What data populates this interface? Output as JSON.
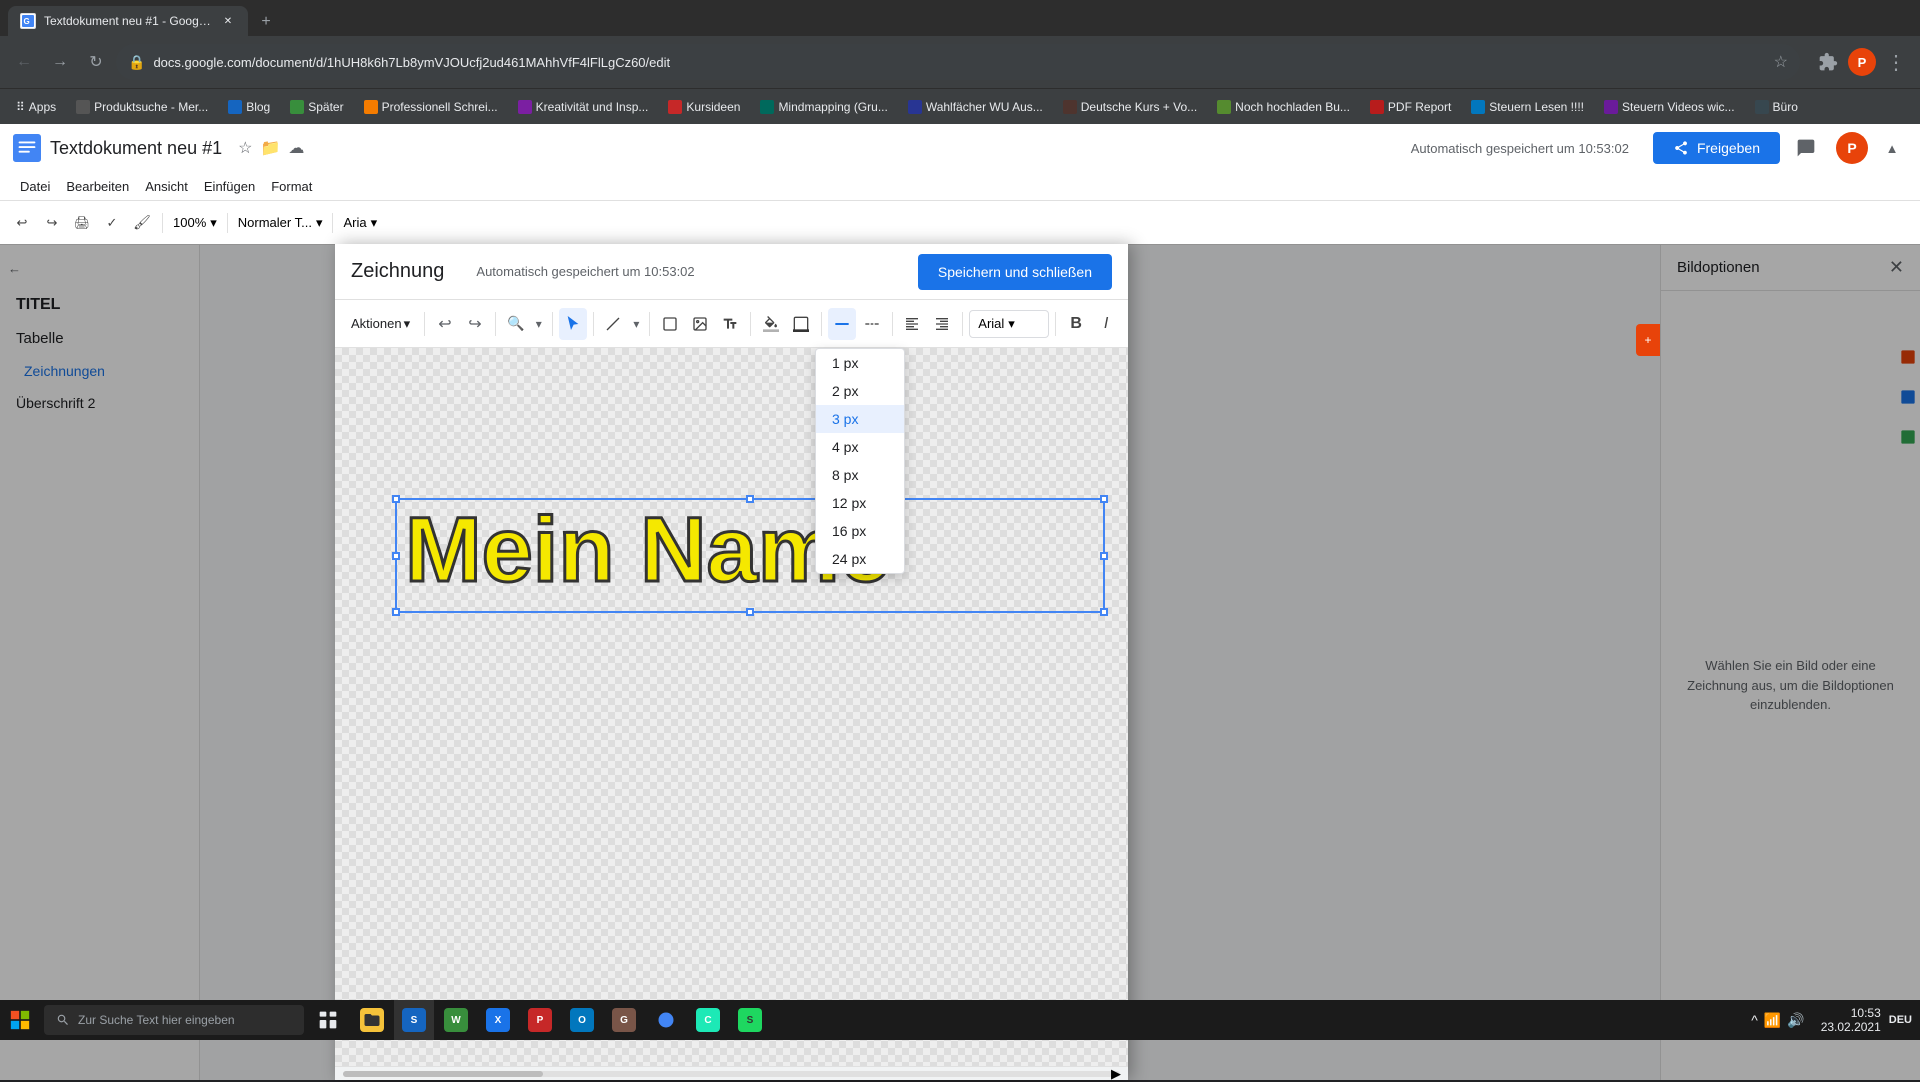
{
  "browser": {
    "tab": {
      "title": "Textdokument neu #1 - Google ...",
      "favicon_color": "#4285f4"
    },
    "address": "docs.google.com/document/d/1hUH8k6h7Lb8ymVJOUcfj2ud461MAhhVfF4lFlLgCz60/edit",
    "bookmarks": [
      {
        "label": "Apps"
      },
      {
        "label": "Produktsuche - Mer..."
      },
      {
        "label": "Blog"
      },
      {
        "label": "Später"
      },
      {
        "label": "Professionell Schrei..."
      },
      {
        "label": "Kreativität und Insp..."
      },
      {
        "label": "Kursideen"
      },
      {
        "label": "Mindmapping (Gru..."
      },
      {
        "label": "Wahlfächer WU Aus..."
      },
      {
        "label": "Deutsche Kurs + Vo..."
      },
      {
        "label": "Noch hochladen Bu..."
      },
      {
        "label": "PDF Report"
      },
      {
        "label": "Steuern Lesen !!!!"
      },
      {
        "label": "Steuern Videos wic..."
      },
      {
        "label": "Büro"
      }
    ]
  },
  "docs": {
    "title": "Textdokument neu #1",
    "menu_items": [
      "Datei",
      "Bearbeiten",
      "Ansicht",
      "Einfügen",
      "Format"
    ],
    "toolbar": {
      "zoom": "100%",
      "style": "Normaler T...",
      "font": "Aria"
    },
    "autosave_text": "Automatisch gespeichert um 10:53:02",
    "share_btn": "Freigeben",
    "user_initial": "P",
    "sidebar": {
      "back_label": "←",
      "items": [
        {
          "label": "TITEL",
          "level": "h1"
        },
        {
          "label": "Tabelle",
          "level": "h2"
        },
        {
          "label": "Zeichnungen",
          "level": "h3"
        },
        {
          "label": "Überschrift 2",
          "level": "h4"
        }
      ]
    }
  },
  "drawing": {
    "title": "Zeichnung",
    "autosave": "Automatisch gespeichert um 10:53:02",
    "save_close_btn": "Speichern und schließen",
    "toolbar": {
      "actions_btn": "Aktionen",
      "font": "Arial",
      "bold_btn": "B",
      "italic_btn": "I"
    },
    "canvas_text": "Mein Name",
    "stroke_dropdown": {
      "options": [
        {
          "label": "1 px",
          "value": "1"
        },
        {
          "label": "2 px",
          "value": "2"
        },
        {
          "label": "3 px",
          "value": "3",
          "selected": true
        },
        {
          "label": "4 px",
          "value": "4"
        },
        {
          "label": "8 px",
          "value": "8"
        },
        {
          "label": "12 px",
          "value": "12"
        },
        {
          "label": "16 px",
          "value": "16"
        },
        {
          "label": "24 px",
          "value": "24"
        }
      ]
    }
  },
  "bildoptionen": {
    "title": "Bildoptionen",
    "hint": "Wählen Sie ein Bild oder eine Zeichnung aus, um die Bildoptionen einzublenden."
  },
  "taskbar": {
    "search_placeholder": "Zur Suche Text hier eingeben",
    "time": "10:53",
    "date": "23.02.2021",
    "language": "DEU"
  }
}
